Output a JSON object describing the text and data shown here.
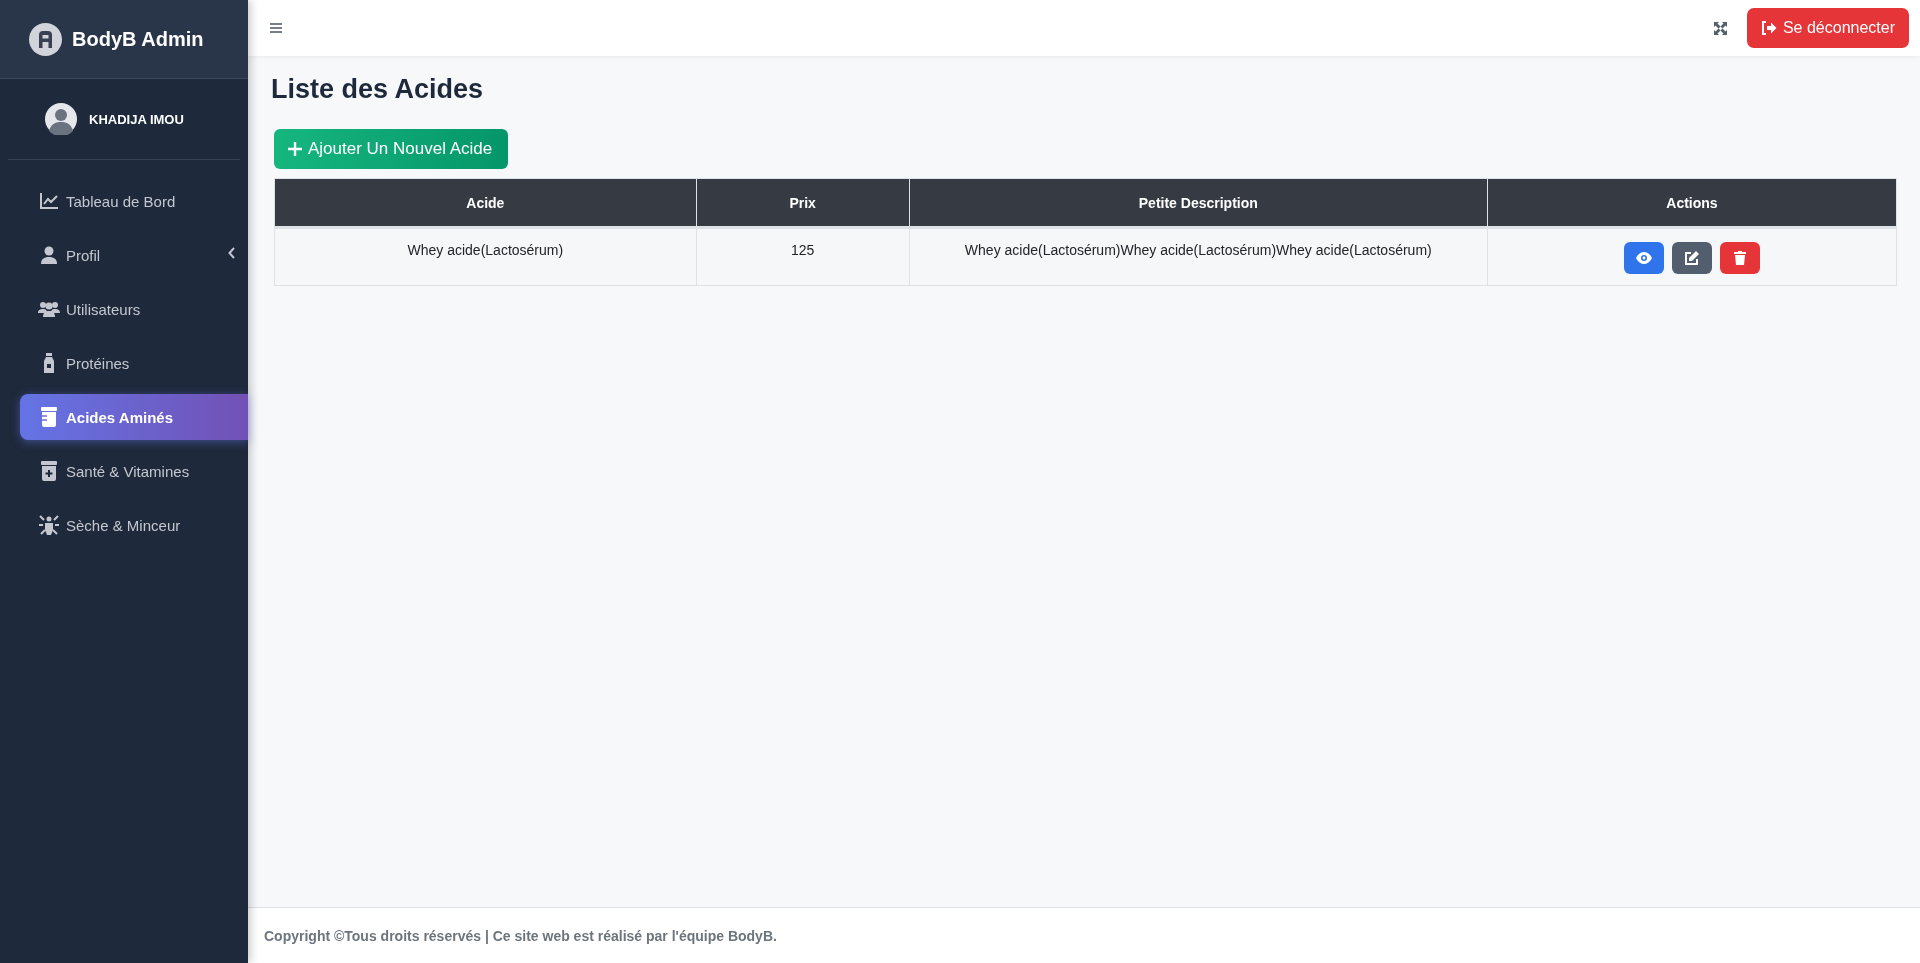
{
  "brand": {
    "name": "BodyB Admin"
  },
  "user": {
    "name": "KHADIJA IMOU"
  },
  "nav": [
    {
      "label": "Tableau de Bord",
      "selected": false,
      "expandable": false
    },
    {
      "label": "Profil",
      "selected": false,
      "expandable": true
    },
    {
      "label": "Utilisateurs",
      "selected": false,
      "expandable": false
    },
    {
      "label": "Protéines",
      "selected": false,
      "expandable": false
    },
    {
      "label": "Acides Aminés",
      "selected": true,
      "expandable": false
    },
    {
      "label": "Santé & Vitamines",
      "selected": false,
      "expandable": false
    },
    {
      "label": "Sèche & Minceur",
      "selected": false,
      "expandable": false
    }
  ],
  "topbar": {
    "logout": "Se déconnecter"
  },
  "page": {
    "title": "Liste des Acides",
    "add_button": "Ajouter Un Nouvel Acide"
  },
  "table": {
    "columns": [
      "Acide",
      "Prix",
      "Petite Description",
      "Actions"
    ],
    "rows": [
      {
        "cells": [
          "Whey acide(Lactosérum)",
          "125",
          "Whey acide(Lactosérum)Whey acide(Lactosérum)Whey acide(Lactosérum)"
        ],
        "actions": [
          {
            "kind": "view"
          },
          {
            "kind": "edit"
          },
          {
            "kind": "delete"
          }
        ]
      }
    ]
  },
  "footer": {
    "text": "Copyright ©Tous droits réservés | Ce site web est réalisé par l'équipe BodyB."
  }
}
